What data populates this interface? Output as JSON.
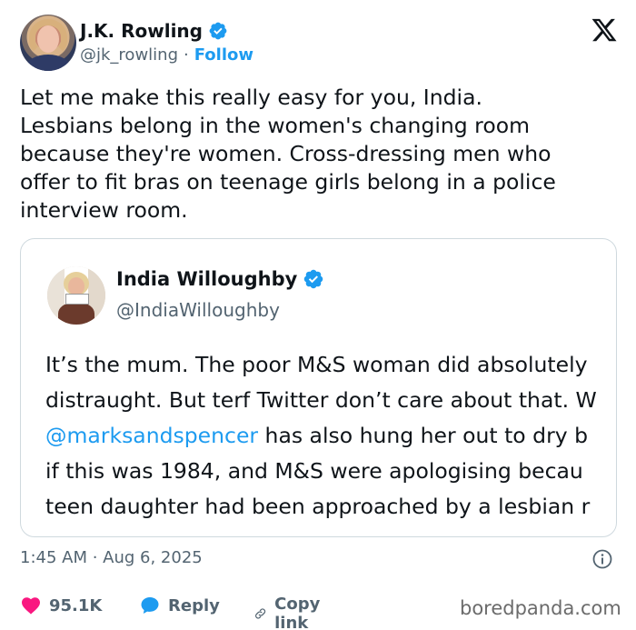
{
  "author": {
    "name": "J.K. Rowling",
    "handle": "@jk_rowling",
    "separator": "·",
    "follow_label": "Follow"
  },
  "tweet": {
    "lines": [
      "Let me make this really easy for you, India.",
      "Lesbians belong in the women's changing room",
      "because they're women. Cross-dressing men who",
      "offer to fit bras on teenage girls belong in a police",
      "interview room."
    ]
  },
  "quoted": {
    "name": "India Willoughby",
    "handle": "@IndiaWilloughby",
    "line1": "It’s the mum. The poor M&S woman did absolutely",
    "line2": "distraught. But terf Twitter don’t care about that. W",
    "line3_mention": "@marksandspencer",
    "line3_rest": " has also hung her out to dry b",
    "line4": "if this was 1984, and M&S were apologising becau",
    "line5": "teen daughter had been approached by a lesbian r"
  },
  "meta": {
    "timestamp": "1:45 AM · Aug 6, 2025"
  },
  "actions": {
    "likes": "95.1K",
    "reply_label": "Reply",
    "copy_label": "Copy link"
  },
  "watermark": "boredpanda.com",
  "icons": {
    "verified": "verified-badge-icon",
    "x_logo": "x-logo-icon",
    "info": "info-icon",
    "heart": "heart-icon",
    "reply": "reply-bubble-icon",
    "link": "link-icon"
  },
  "colors": {
    "accent": "#1d9bf0",
    "like": "#f91880",
    "text": "#0f1419",
    "muted": "#536471",
    "border": "#cfd9de"
  }
}
